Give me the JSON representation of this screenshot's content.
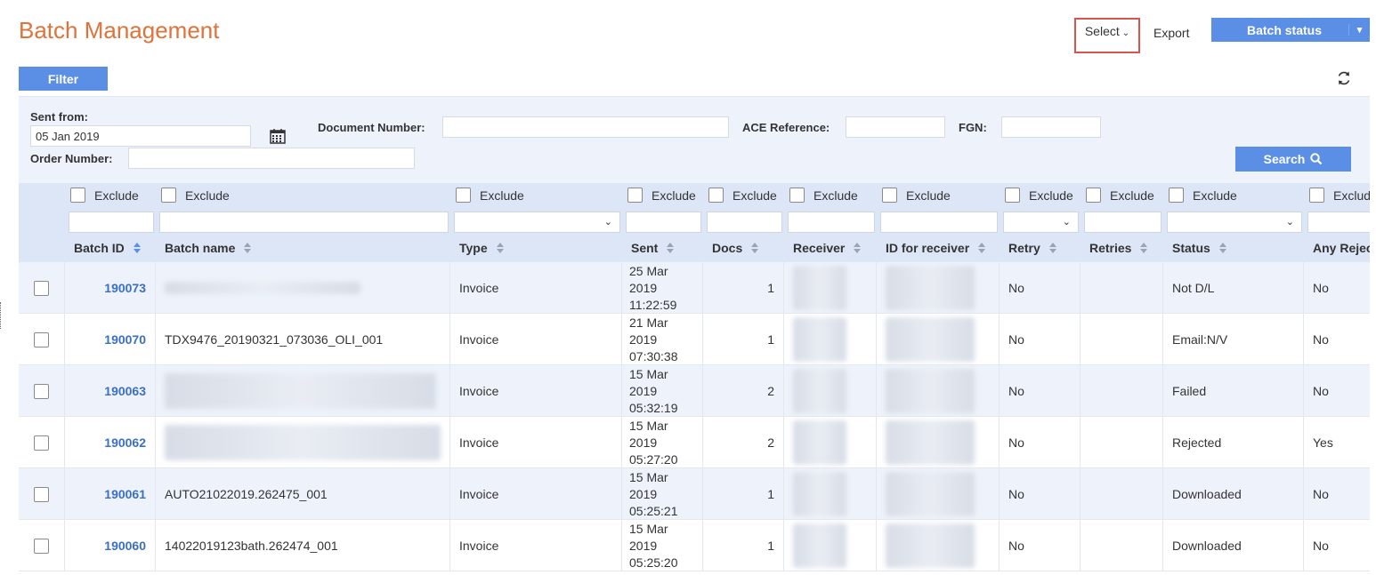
{
  "page": {
    "title": "Batch Management",
    "select_label": "Select",
    "export_label": "Export",
    "batch_status_label": "Batch status",
    "filter_label": "Filter"
  },
  "filters": {
    "sent_from_label": "Sent from:",
    "sent_from_value": "05 Jan 2019",
    "document_number_label": "Document Number:",
    "ace_reference_label": "ACE Reference:",
    "fgn_label": "FGN:",
    "order_number_label": "Order Number:",
    "search_label": "Search"
  },
  "grid": {
    "exclude_label": "Exclude",
    "columns": [
      "Batch ID",
      "Batch name",
      "Type",
      "Sent",
      "Docs",
      "Receiver",
      "ID for receiver",
      "Retry",
      "Retries",
      "Status",
      "Any Rejec"
    ],
    "rows": [
      {
        "batch_id": "190073",
        "batch_name": "",
        "type": "Invoice",
        "sent": "25 Mar 2019 11:22:59",
        "docs": "1",
        "retry": "No",
        "retries": "",
        "status": "Not D/L",
        "any_rejected": "No"
      },
      {
        "batch_id": "190070",
        "batch_name": "TDX9476_20190321_073036_OLI_001",
        "type": "Invoice",
        "sent": "21 Mar 2019 07:30:38",
        "docs": "1",
        "retry": "No",
        "retries": "",
        "status": "Email:N/V",
        "any_rejected": "No"
      },
      {
        "batch_id": "190063",
        "batch_name": "",
        "type": "Invoice",
        "sent": "15 Mar 2019 05:32:19",
        "docs": "2",
        "retry": "No",
        "retries": "",
        "status": "Failed",
        "any_rejected": "No"
      },
      {
        "batch_id": "190062",
        "batch_name": "",
        "type": "Invoice",
        "sent": "15 Mar 2019 05:27:20",
        "docs": "2",
        "retry": "No",
        "retries": "",
        "status": "Rejected",
        "any_rejected": "Yes"
      },
      {
        "batch_id": "190061",
        "batch_name": "AUTO21022019.262475_001",
        "type": "Invoice",
        "sent": "15 Mar 2019 05:25:21",
        "docs": "1",
        "retry": "No",
        "retries": "",
        "status": "Downloaded",
        "any_rejected": "No"
      },
      {
        "batch_id": "190060",
        "batch_name": "14022019123bath.262474_001",
        "type": "Invoice",
        "sent": "15 Mar 2019 05:25:20",
        "docs": "1",
        "retry": "No",
        "retries": "",
        "status": "Downloaded",
        "any_rejected": "No"
      }
    ]
  },
  "icons": {
    "calendar": "calendar-icon",
    "search": "search-icon",
    "refresh": "refresh-icon"
  },
  "colors": {
    "title": "#e0723a",
    "primary": "#5b8fe6",
    "link": "#3a6fc4",
    "highlight_border": "#d9534f"
  }
}
